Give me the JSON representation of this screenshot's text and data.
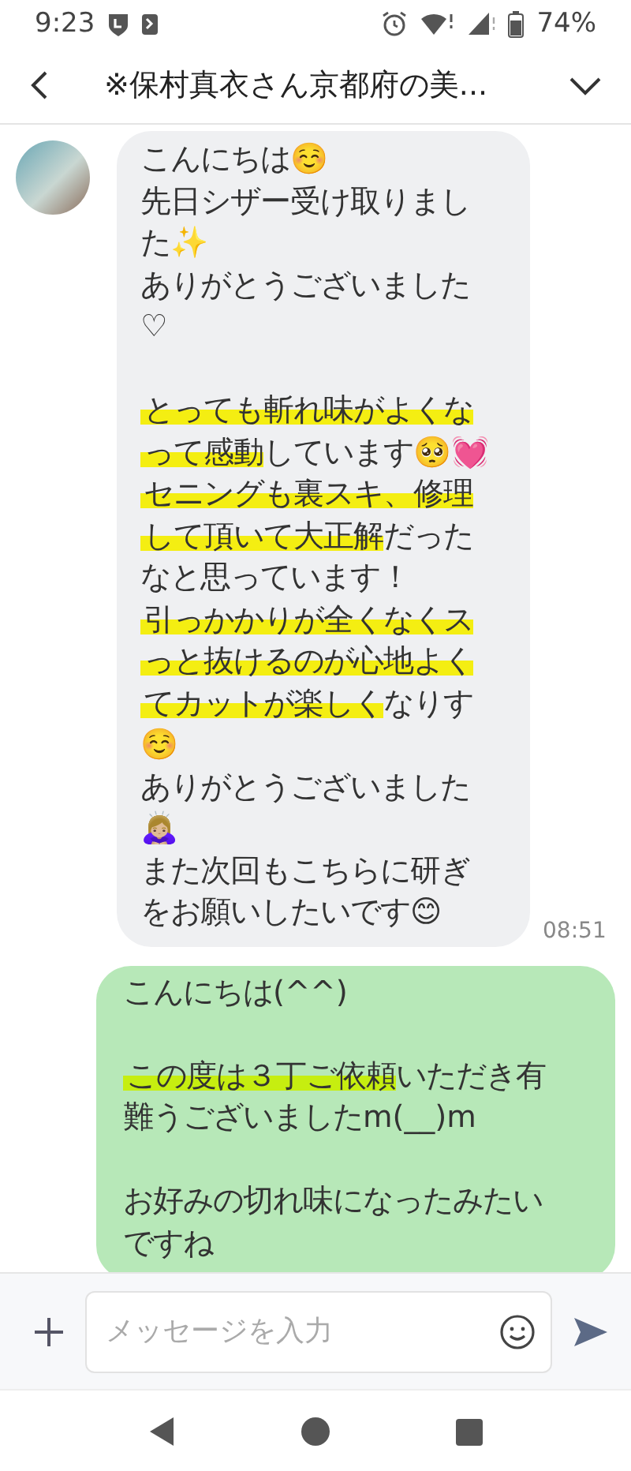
{
  "status_bar": {
    "time": "9:23",
    "battery": "74%"
  },
  "header": {
    "title": "※保村真衣さん京都府の美..."
  },
  "messages": [
    {
      "kind": "received",
      "time": "08:51",
      "paragraphs": [
        [
          [
            {
              "text": "こんにちは☺️",
              "highlighted": false
            }
          ],
          [
            {
              "text": "先日シザー受け取りまし",
              "highlighted": false
            }
          ],
          [
            {
              "text": "た✨",
              "highlighted": false
            }
          ],
          [
            {
              "text": "ありがとうございました",
              "highlighted": false
            }
          ],
          [
            {
              "text": "♡",
              "highlighted": false
            }
          ]
        ],
        [
          [
            {
              "text": "とっても斬れ味がよくな",
              "highlighted": true
            }
          ],
          [
            {
              "text": "って感動",
              "highlighted": true
            },
            {
              "text": "しています🥺💓",
              "highlighted": false
            }
          ],
          [
            {
              "text": "セニングも裏スキ、修理",
              "highlighted": true
            }
          ],
          [
            {
              "text": "して頂いて大正解",
              "highlighted": true
            },
            {
              "text": "だった",
              "highlighted": false
            }
          ],
          [
            {
              "text": "なと思っています！",
              "highlighted": false
            }
          ],
          [
            {
              "text": "引っかかりが全くなくス",
              "highlighted": true
            }
          ],
          [
            {
              "text": "っと抜けるのが心地よく",
              "highlighted": true
            }
          ],
          [
            {
              "text": "てカットが楽しく",
              "highlighted": true
            },
            {
              "text": "なりす",
              "highlighted": false
            }
          ],
          [
            {
              "text": "☺️",
              "highlighted": false
            }
          ],
          [
            {
              "text": "ありがとうございました",
              "highlighted": false
            }
          ],
          [
            {
              "text": "🙇🏼‍♀️",
              "highlighted": false
            }
          ],
          [
            {
              "text": "また次回もこちらに研ぎ",
              "highlighted": false
            }
          ],
          [
            {
              "text": "をお願いしたいです😊",
              "highlighted": false
            }
          ]
        ]
      ]
    },
    {
      "kind": "sent",
      "paragraphs": [
        [
          [
            {
              "text": "こんにちは(^^)",
              "highlighted": false
            }
          ]
        ],
        [
          [
            {
              "text": "この度は３丁ご依頼",
              "highlighted": true
            },
            {
              "text": "いただき有",
              "highlighted": false
            }
          ],
          [
            {
              "text": "難うございましたm(__)m",
              "highlighted": false
            }
          ]
        ],
        [
          [
            {
              "text": "お好みの切れ味になったみたい",
              "highlighted": false
            }
          ],
          [
            {
              "text": "ですね",
              "highlighted": false
            }
          ]
        ]
      ]
    }
  ],
  "composer": {
    "placeholder": "メッセージを入力"
  }
}
